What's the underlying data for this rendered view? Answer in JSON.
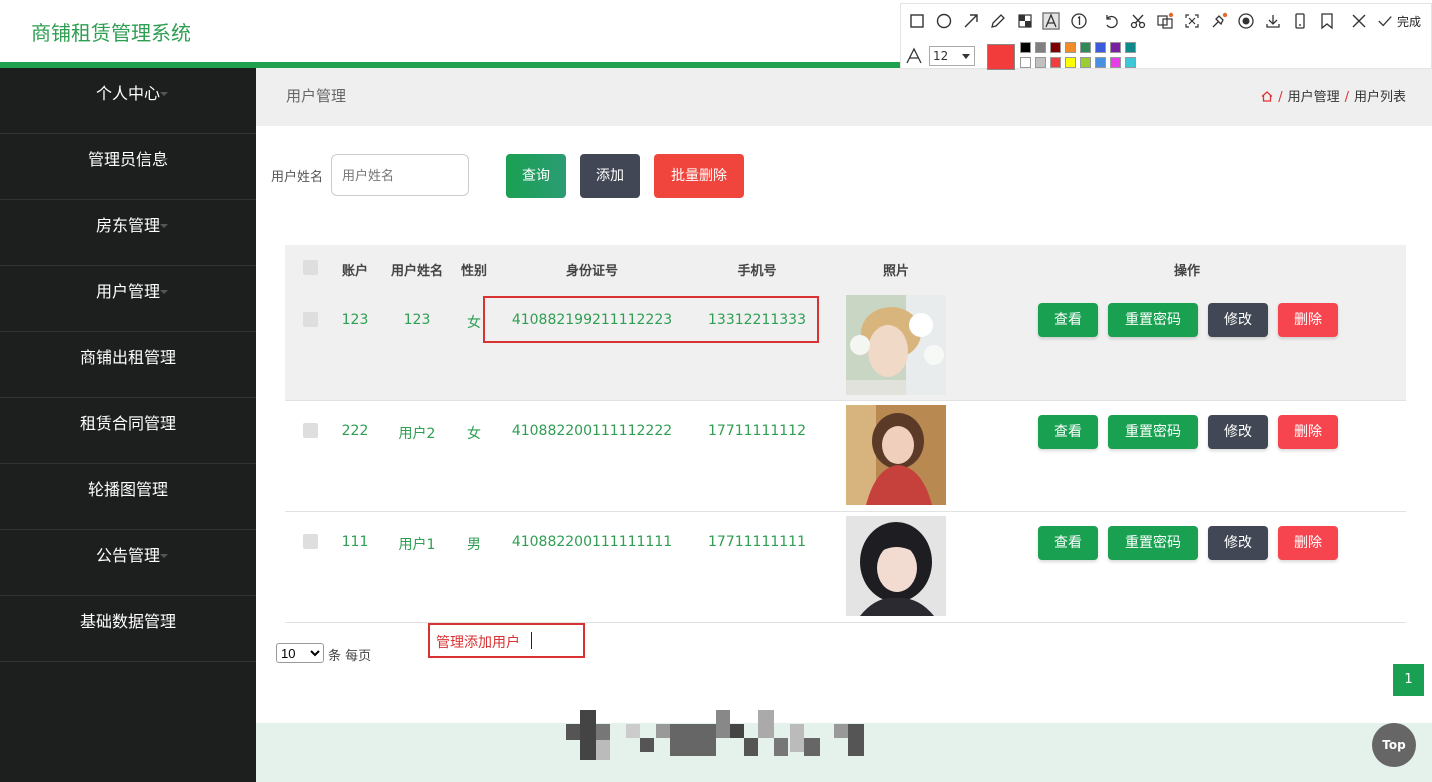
{
  "app": {
    "title": "商铺租赁管理系统"
  },
  "sidebar": {
    "items": [
      {
        "label": "个人中心"
      },
      {
        "label": "管理员信息"
      },
      {
        "label": "房东管理"
      },
      {
        "label": "用户管理"
      },
      {
        "label": "商铺出租管理"
      },
      {
        "label": "租赁合同管理"
      },
      {
        "label": "轮播图管理"
      },
      {
        "label": "公告管理"
      },
      {
        "label": "基础数据管理"
      }
    ]
  },
  "breadcrumb": {
    "page_title": "用户管理",
    "items": [
      "用户管理",
      "用户列表"
    ],
    "separator": "/"
  },
  "search": {
    "label": "用户姓名",
    "placeholder": "用户姓名",
    "query_button": "查询",
    "add_button": "添加",
    "batch_delete_button": "批量删除"
  },
  "table": {
    "headers": [
      "账户",
      "用户姓名",
      "性别",
      "身份证号",
      "手机号",
      "照片",
      "操作"
    ],
    "rows": [
      {
        "account": "123",
        "name": "123",
        "gender": "女",
        "id_number": "410882199211112223",
        "phone": "13312211333"
      },
      {
        "account": "222",
        "name": "用户2",
        "gender": "女",
        "id_number": "410882200111112222",
        "phone": "17711111112"
      },
      {
        "account": "111",
        "name": "用户1",
        "gender": "男",
        "id_number": "410882200111111111",
        "phone": "17711111111"
      }
    ],
    "actions": {
      "view": "查看",
      "reset_password": "重置密码",
      "edit": "修改",
      "delete": "删除"
    }
  },
  "pagination": {
    "page_size": "10",
    "per_page_label": "条 每页",
    "current_page": "1"
  },
  "annotation": {
    "text": "管理添加用户"
  },
  "top_button": "Top",
  "screenshot_toolbar": {
    "done_label": "完成",
    "font_size": "12",
    "current_color": "#f23c3c",
    "icons": [
      "rectangle-icon",
      "ellipse-icon",
      "arrow-icon",
      "pencil-icon",
      "mosaic-icon",
      "text-icon",
      "number-icon",
      "undo-icon",
      "cut-icon",
      "ocr-icon",
      "expand-icon",
      "pin-icon",
      "record-icon",
      "download-icon",
      "phone-icon",
      "bookmark-icon",
      "close-icon",
      "check-icon"
    ],
    "palette": [
      "#000000",
      "#808080",
      "#800000",
      "#f28c28",
      "#2e8b57",
      "#3b5bdb",
      "#7b1fa2",
      "#0f8a8a",
      "#ffffff",
      "#c0c0c0",
      "#f03e3e",
      "#ffff00",
      "#9acd32",
      "#4a90e2",
      "#e83ce8",
      "#3cc8d8"
    ]
  },
  "colors": {
    "brand_green": "#1aa052",
    "sidebar_bg": "#1d1f1e",
    "dark_button": "#414754",
    "danger": "#f0453d",
    "highlight_red": "#d93232"
  }
}
